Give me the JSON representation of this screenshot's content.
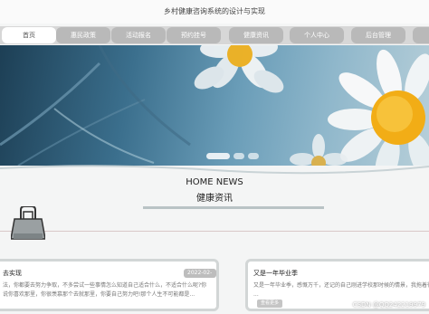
{
  "header": {
    "title": "乡村健康咨询系统的设计与实现"
  },
  "nav": {
    "items": [
      {
        "label": "首页",
        "active": true
      },
      {
        "label": "惠民政策",
        "active": false
      },
      {
        "label": "活动报名",
        "active": false
      },
      {
        "label": "预约挂号",
        "active": false
      },
      {
        "label": "健康资讯",
        "active": false
      },
      {
        "label": "个人中心",
        "active": false
      },
      {
        "label": "后台管理",
        "active": false
      }
    ]
  },
  "banner": {
    "slides": 3,
    "current": 1
  },
  "section": {
    "title_en": "HOME NEWS",
    "title_cn": "健康资讯"
  },
  "news": [
    {
      "title": "去实现",
      "date": "2022-02-08",
      "text_1": "法，你都要去努力争取，不多尝试一些事情怎么知道自己适合什么，不适合什么呢?你",
      "text_2": "说你喜欢那里，你很羡慕那个去就那里，你要自己努力吧!那个人生不可能都是..."
    },
    {
      "title": "又是一年毕业季",
      "date": "",
      "text_1": "又是一年毕业季，感慨万千，还记的自己刚进学校那时候的情景，我拖着行李箱",
      "text_2": "...",
      "tag": "查看更多"
    }
  ],
  "watermark": "CSDN @QQ242219979",
  "colors": {
    "nav_bg": "#d7d7d7",
    "nav_item": "#b9b9b9",
    "nav_active": "#ffffff",
    "accent": "#b9c3c5"
  }
}
